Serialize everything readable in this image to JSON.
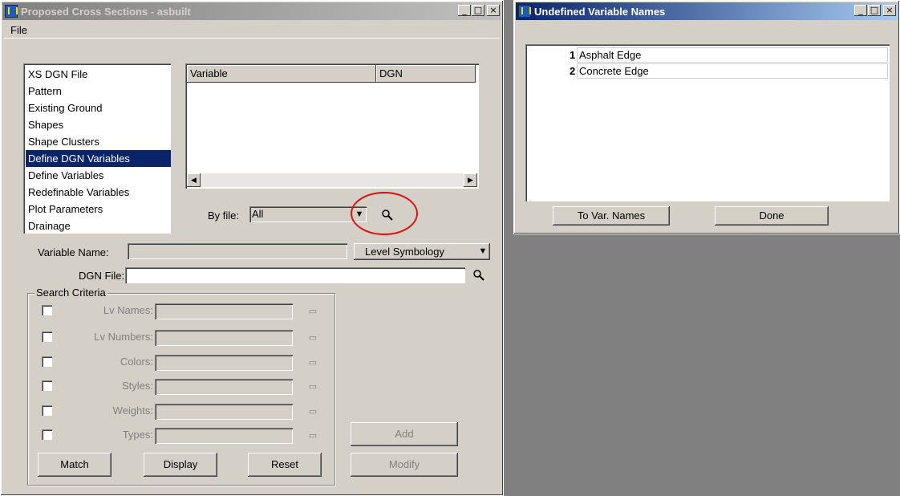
{
  "left_window": {
    "title": "Proposed Cross Sections - asbuilt",
    "title_buttons": [
      "_",
      "□",
      "×"
    ],
    "menu": {
      "file": "File"
    },
    "category_list": [
      "XS DGN File",
      "Pattern",
      "Existing Ground",
      "Shapes",
      "Shape Clusters",
      "Define DGN Variables",
      "Define Variables",
      "Redefinable Variables",
      "Plot Parameters",
      "Drainage"
    ],
    "selected_category": "Define DGN Variables",
    "grid": {
      "col_variable": "Variable",
      "col_dgn": "DGN"
    },
    "by_file": {
      "label": "By file:",
      "value": "All"
    },
    "variable_name": {
      "label": "Variable Name:",
      "value": ""
    },
    "symbology": {
      "value": "Level Symbology"
    },
    "dgn_file": {
      "label": "DGN File:",
      "value": ""
    },
    "search_criteria": {
      "title": "Search Criteria",
      "rows": [
        {
          "label": "Lv Names:",
          "checked": false
        },
        {
          "label": "Lv Numbers:",
          "checked": false
        },
        {
          "label": "Colors:",
          "checked": false
        },
        {
          "label": "Styles:",
          "checked": false
        },
        {
          "label": "Weights:",
          "checked": false
        },
        {
          "label": "Types:",
          "checked": false
        }
      ],
      "match": "Match",
      "display": "Display",
      "reset": "Reset"
    },
    "add": "Add",
    "modify": "Modify"
  },
  "right_window": {
    "title": "Undefined Variable Names",
    "title_buttons": [
      "_",
      "□",
      "×"
    ],
    "items": [
      {
        "num": "1",
        "name": "Asphalt Edge"
      },
      {
        "num": "2",
        "name": "Concrete Edge"
      }
    ],
    "to_var_names": "To Var. Names",
    "done": "Done"
  },
  "annotation_color": "#e01010",
  "icons": {
    "search": "magnifier-icon",
    "picker": "level-picker-icon",
    "dropdown": "dropdown-arrow-icon",
    "app": "app-icon"
  }
}
